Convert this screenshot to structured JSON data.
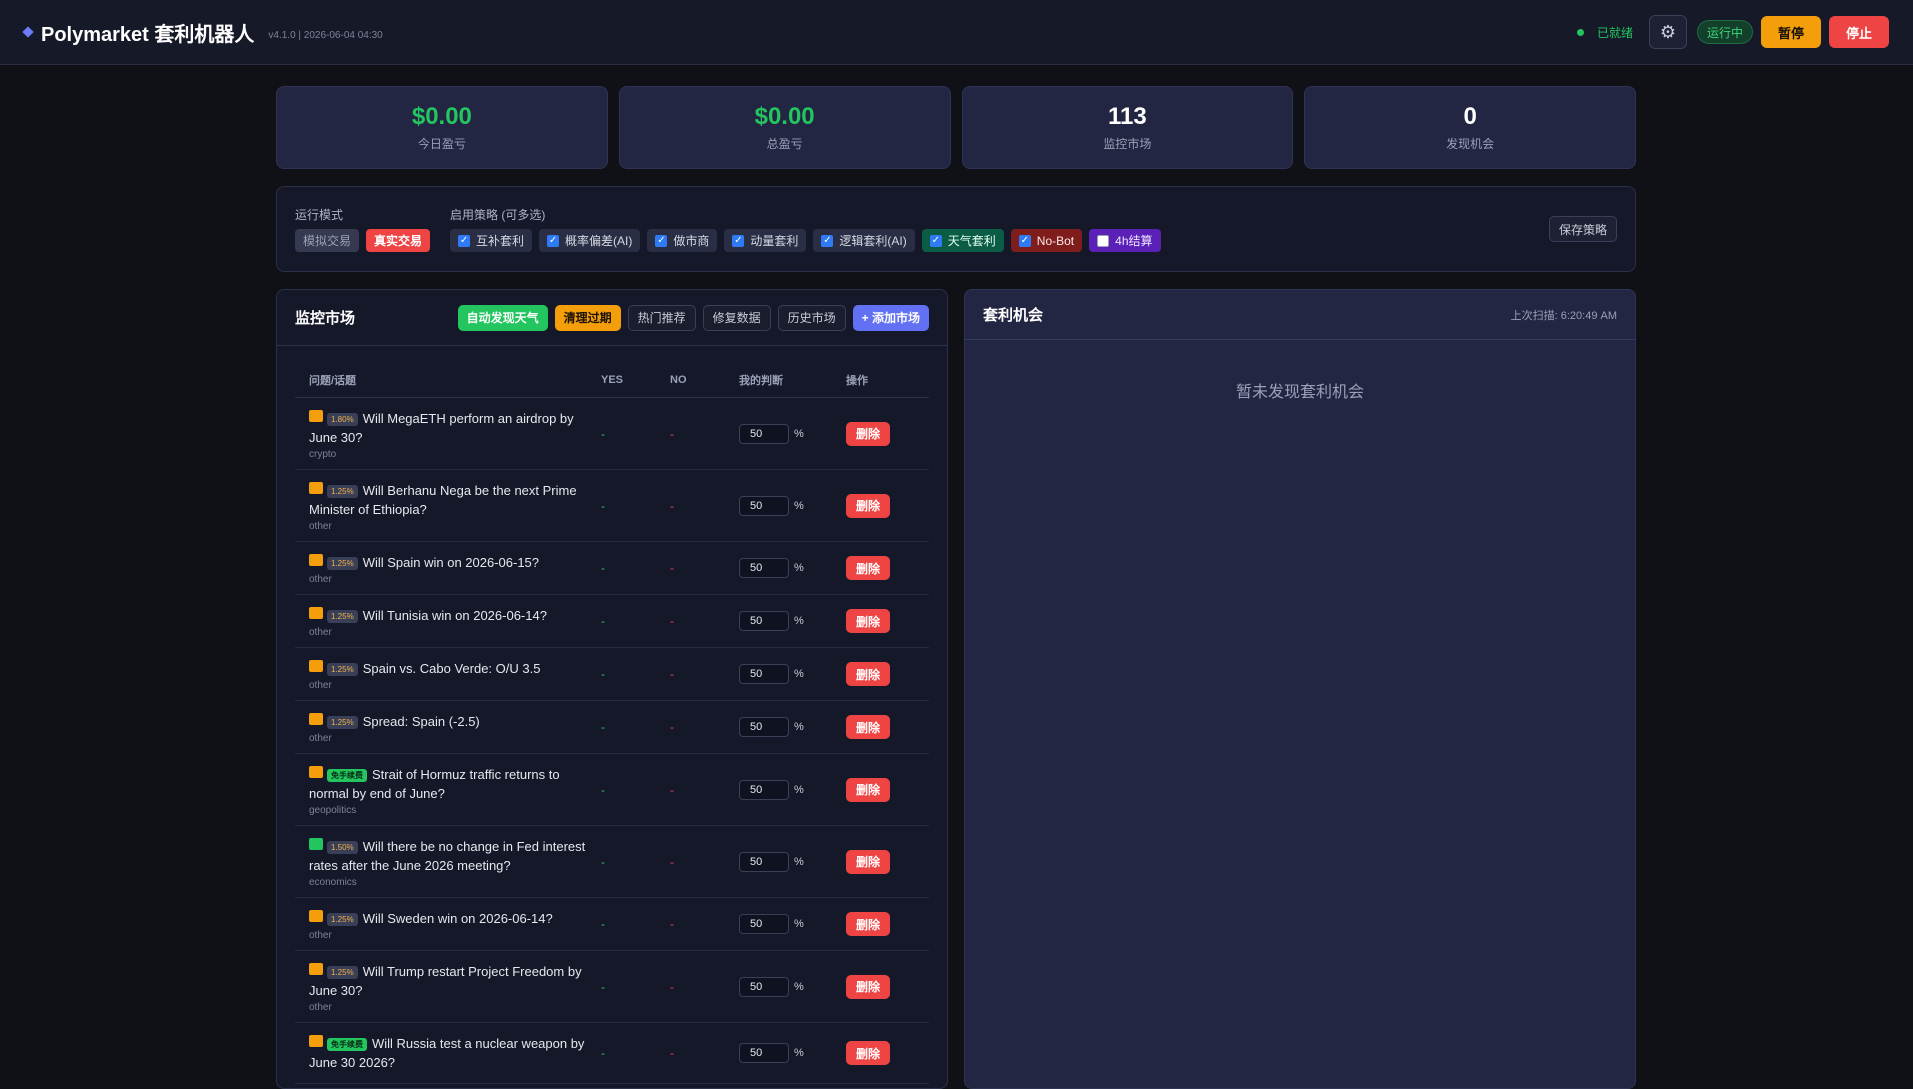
{
  "header": {
    "title": "Polymarket 套利机器人",
    "version": "v4.1.0 | 2026-06-04 04:30",
    "status_ready": "已就绪",
    "running_badge": "运行中",
    "pause_label": "暂停",
    "stop_label": "停止"
  },
  "stats": [
    {
      "value": "$0.00",
      "label": "今日盈亏"
    },
    {
      "value": "$0.00",
      "label": "总盈亏"
    },
    {
      "value": "113",
      "label": "监控市场"
    },
    {
      "value": "0",
      "label": "发现机会"
    }
  ],
  "strategy": {
    "mode_label": "运行模式",
    "mode_sim": "模拟交易",
    "mode_real": "真实交易",
    "strategies_label": "启用策略 (可多选)",
    "items": [
      {
        "label": "互补套利",
        "checked": true
      },
      {
        "label": "概率偏差(AI)",
        "checked": true
      },
      {
        "label": "做市商",
        "checked": true
      },
      {
        "label": "动量套利",
        "checked": true
      },
      {
        "label": "逻辑套利(AI)",
        "checked": true
      },
      {
        "label": "天气套利",
        "checked": true
      },
      {
        "label": "No-Bot",
        "checked": true
      },
      {
        "label": "4h结算",
        "checked": false
      }
    ],
    "save_label": "保存策略"
  },
  "monitor": {
    "title": "监控市场",
    "actions": {
      "auto_weather": "自动发现天气",
      "cleanup": "清理过期",
      "hot": "热门推荐",
      "repair": "修复数据",
      "history": "历史市场",
      "add": "+ 添加市场"
    },
    "columns": {
      "question": "问题/话题",
      "yes": "YES",
      "no": "NO",
      "judge": "我的判断",
      "op": "操作"
    },
    "rows": [
      {
        "tag": "1.80%",
        "question": "Will MegaETH perform an airdrop by June 30?",
        "category": "crypto",
        "yes": "-",
        "no": "-",
        "judge": "50",
        "delete": "删除"
      },
      {
        "tag": "1.25%",
        "question": "Will Berhanu Nega be the next Prime Minister of Ethiopia?",
        "category": "other",
        "yes": "-",
        "no": "-",
        "judge": "50",
        "delete": "删除"
      },
      {
        "tag": "1.25%",
        "question": "Will Spain win on 2026-06-15?",
        "category": "other",
        "yes": "-",
        "no": "-",
        "judge": "50",
        "delete": "删除"
      },
      {
        "tag": "1.25%",
        "question": "Will Tunisia win on 2026-06-14?",
        "category": "other",
        "yes": "-",
        "no": "-",
        "judge": "50",
        "delete": "删除"
      },
      {
        "tag": "1.25%",
        "question": "Spain vs. Cabo Verde: O/U 3.5",
        "category": "other",
        "yes": "-",
        "no": "-",
        "judge": "50",
        "delete": "删除"
      },
      {
        "tag": "1.25%",
        "question": "Spread: Spain (-2.5)",
        "category": "other",
        "yes": "-",
        "no": "-",
        "judge": "50",
        "delete": "删除"
      },
      {
        "tag": "免手续费",
        "question": "Strait of Hormuz traffic returns to normal by end of June?",
        "category": "geopolitics",
        "yes": "-",
        "no": "-",
        "judge": "50",
        "delete": "删除"
      },
      {
        "tag": "1.50%",
        "question": "Will there be no change in Fed interest rates after the June 2026 meeting?",
        "category": "economics",
        "yes": "-",
        "no": "-",
        "judge": "50",
        "delete": "删除"
      },
      {
        "tag": "1.25%",
        "question": "Will Sweden win on 2026-06-14?",
        "category": "other",
        "yes": "-",
        "no": "-",
        "judge": "50",
        "delete": "删除"
      },
      {
        "tag": "1.25%",
        "question": "Will Trump restart Project Freedom by June 30?",
        "category": "other",
        "yes": "-",
        "no": "-",
        "judge": "50",
        "delete": "删除"
      },
      {
        "tag": "免手续费",
        "question": "Will Russia test a nuclear weapon by June 30 2026?",
        "category": "",
        "yes": "-",
        "no": "-",
        "judge": "50",
        "delete": "删除"
      }
    ],
    "percent_sign": "%"
  },
  "opportunities": {
    "title": "套利机会",
    "last_scan": "上次扫描: 6:20:49 AM",
    "empty": "暂未发现套利机会"
  },
  "colors": {
    "accent": "#6271f4",
    "success": "#22c55e",
    "warning": "#f59e0b",
    "danger": "#ef4444",
    "background": "#0f1117"
  }
}
